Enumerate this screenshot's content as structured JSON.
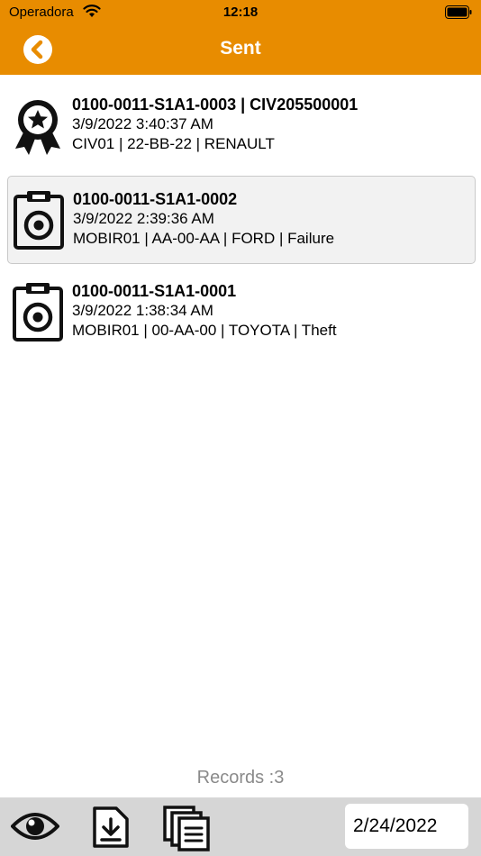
{
  "status_bar": {
    "carrier": "Operadora",
    "time": "12:18"
  },
  "nav": {
    "title": "Sent",
    "back_icon": "chevron-left-circle-icon"
  },
  "colors": {
    "accent": "#E88C00",
    "toolbar": "#d6d6d6",
    "selected_row": "#f2f2f2"
  },
  "rows": [
    {
      "icon": "award-badge-icon",
      "line1": "0100-0011-S1A1-0003 | CIV205500001",
      "line2": "3/9/2022 3:40:37 AM",
      "line3": "CIV01 | 22-BB-22 | RENAULT"
    },
    {
      "icon": "camera-clipboard-icon",
      "line1": "0100-0011-S1A1-0002",
      "line2": "3/9/2022 2:39:36 AM",
      "line3": "MOBIR01 | AA-00-AA | FORD | Failure",
      "selected": true
    },
    {
      "icon": "camera-clipboard-icon",
      "line1": "0100-0011-S1A1-0001",
      "line2": "3/9/2022 1:38:34 AM",
      "line3": "MOBIR01 | 00-AA-00 | TOYOTA | Theft"
    }
  ],
  "footer": {
    "records": "Records :3"
  },
  "toolbar": {
    "view_icon": "eye-icon",
    "download_icon": "download-icon",
    "copy_icon": "copy-documents-icon",
    "date": "2/24/2022"
  }
}
